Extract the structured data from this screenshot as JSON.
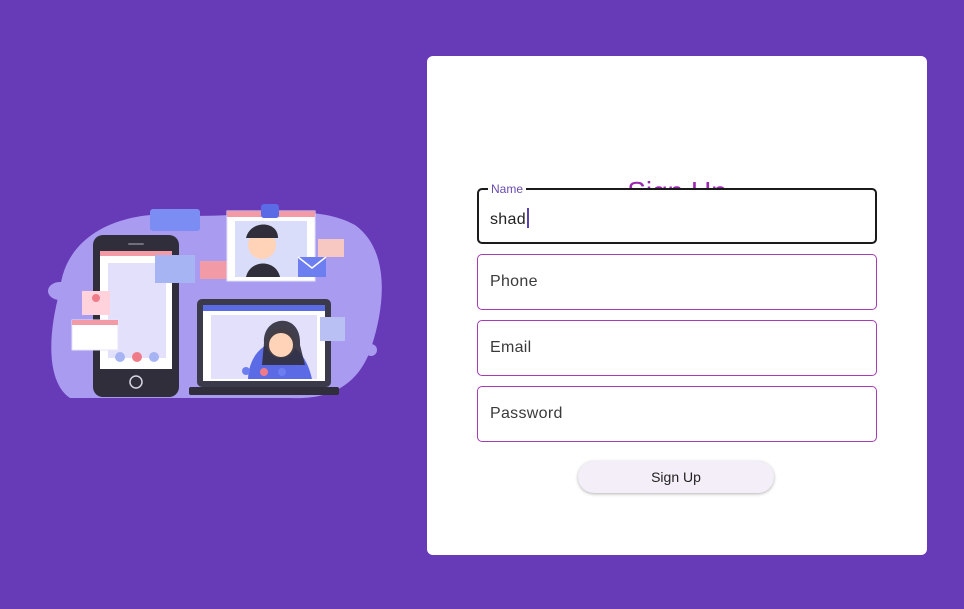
{
  "form": {
    "title": "Sign Up",
    "fields": [
      {
        "label": "Name",
        "value": "shad",
        "focused": true
      },
      {
        "placeholder": "Phone"
      },
      {
        "placeholder": "Email"
      },
      {
        "placeholder": "Password"
      }
    ],
    "submit_label": "Sign Up"
  },
  "colors": {
    "background": "#673ab7",
    "title": "#9c27b0",
    "field_border": "#a63bb5"
  }
}
